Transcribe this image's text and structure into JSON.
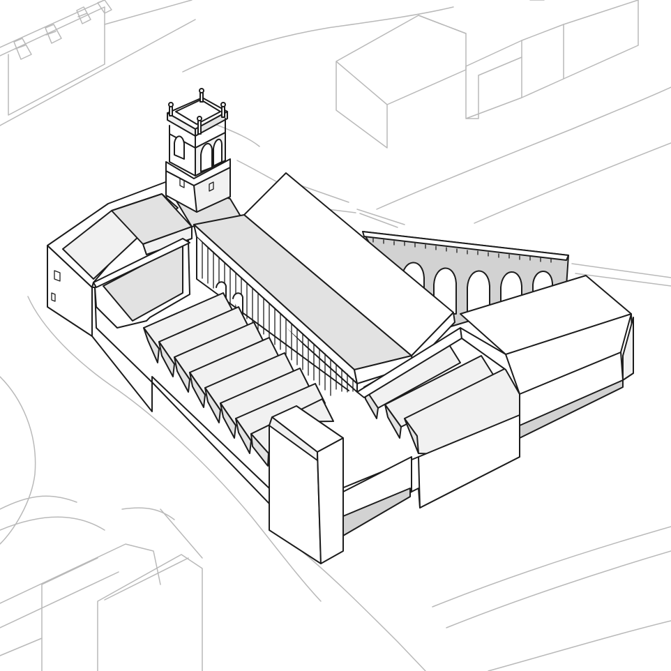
{
  "drawing": {
    "palette": {
      "background": "#ffffff",
      "ink": "#1c1c1c",
      "context_ink": "#b9b9b9",
      "light_fill": "#f1f1f1",
      "mid_fill": "#e2e2e2",
      "dark_fill": "#d2d2d2"
    },
    "elements": [
      "context-buildings",
      "context-streets",
      "bell-tower",
      "gabled-hall-roof",
      "colonnade",
      "arched-aqueduct-wall",
      "sawtooth-roof-left",
      "sawtooth-roof-right",
      "new-building-block"
    ]
  }
}
